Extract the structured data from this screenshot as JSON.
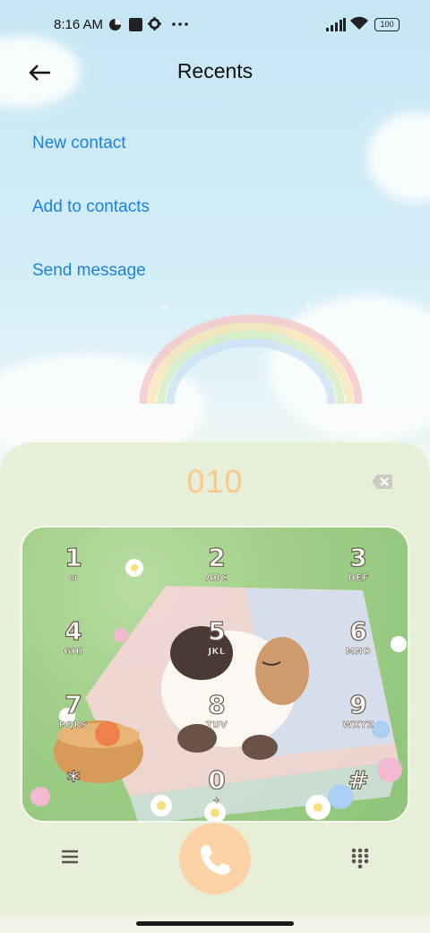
{
  "status_bar": {
    "time": "8:16 AM",
    "battery": "100",
    "icons": [
      "data-saver-icon",
      "stop-icon",
      "settings-icon",
      "more-icon",
      "signal-icon",
      "wifi-icon",
      "battery-icon"
    ]
  },
  "header": {
    "title": "Recents",
    "back_icon": "arrow-left-icon"
  },
  "actions": [
    {
      "label": "New contact"
    },
    {
      "label": "Add to contacts"
    },
    {
      "label": "Send message"
    }
  ],
  "dialer": {
    "number": "010",
    "backspace_icon": "backspace-icon",
    "keys": [
      {
        "digit": "1",
        "letters": "ω"
      },
      {
        "digit": "2",
        "letters": "ABC"
      },
      {
        "digit": "3",
        "letters": "DEF"
      },
      {
        "digit": "4",
        "letters": "GHI"
      },
      {
        "digit": "5",
        "letters": "JKL"
      },
      {
        "digit": "6",
        "letters": "MNO"
      },
      {
        "digit": "7",
        "letters": "PQRS"
      },
      {
        "digit": "8",
        "letters": "TUV"
      },
      {
        "digit": "9",
        "letters": "WXYZ"
      },
      {
        "digit": "*",
        "letters": ""
      },
      {
        "digit": "0",
        "letters": "+"
      },
      {
        "digit": "#",
        "letters": ""
      }
    ]
  },
  "bottom_bar": {
    "menu_icon": "menu-icon",
    "call_icon": "phone-icon",
    "keypad_icon": "dialpad-icon"
  },
  "colors": {
    "link": "#1d82dc",
    "dialed_number": "#f7c98c",
    "call_button": "#fbd3a6",
    "panel": "#e8efd9"
  }
}
